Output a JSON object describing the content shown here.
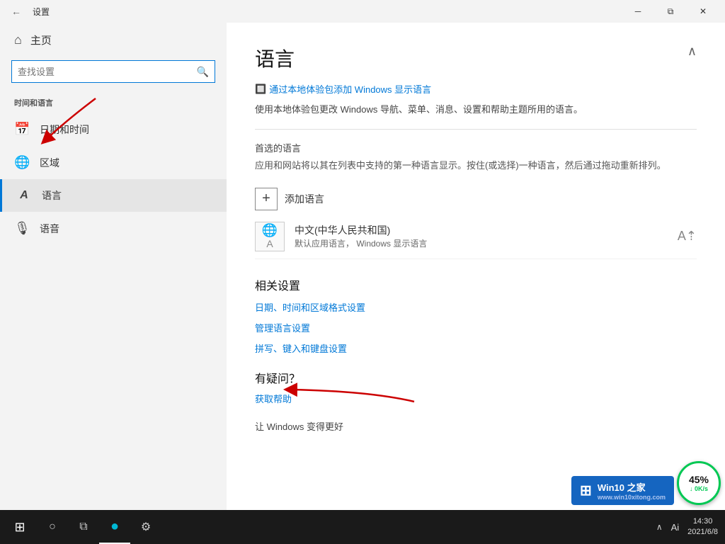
{
  "window": {
    "title": "设置",
    "back_tooltip": "返回"
  },
  "titlebar": {
    "minimize": "─",
    "restore": "⧉",
    "close": "✕"
  },
  "sidebar": {
    "home_label": "主页",
    "search_placeholder": "查找设置",
    "section_title": "时间和语言",
    "items": [
      {
        "id": "datetime",
        "icon": "🗓",
        "label": "日期和时间"
      },
      {
        "id": "region",
        "icon": "🌐",
        "label": "区域"
      },
      {
        "id": "language",
        "icon": "A",
        "label": "语言",
        "active": true
      },
      {
        "id": "speech",
        "icon": "🎙",
        "label": "语音"
      }
    ]
  },
  "content": {
    "page_title": "语言",
    "add_language_link": "通过本地体验包添加 Windows 显示语言",
    "description": "使用本地体验包更改 Windows 导航、菜单、消息、设置和帮助主题所用的语言。",
    "preferred_section": "首选的语言",
    "preferred_description": "应用和网站将以其在列表中支持的第一种语言显示。按住(或选择)一种语言，然后通过拖动重新排列。",
    "add_language_btn": "添加语言",
    "language_item": {
      "name": "中文(中华人民共和国)",
      "sub": "默认应用语言，  Windows 显示语言"
    },
    "related_settings_title": "相关设置",
    "related_links": [
      "日期、时间和区域格式设置",
      "管理语言设置",
      "拼写、键入和键盘设置"
    ],
    "faq_title": "有疑问？",
    "faq_link": "获取帮助",
    "bottom_text": "让 Windows 变得更好"
  },
  "taskbar": {
    "time": "14:30",
    "date": "2021/6/8",
    "chevron": "∧",
    "lang_label": "Ai"
  },
  "speed_overlay": {
    "percent": "45%",
    "speed": "↓ 0K/s"
  },
  "watermark": {
    "logo": "⊞",
    "text": "Win10 之家",
    "site": "www.win10xitong.com"
  }
}
